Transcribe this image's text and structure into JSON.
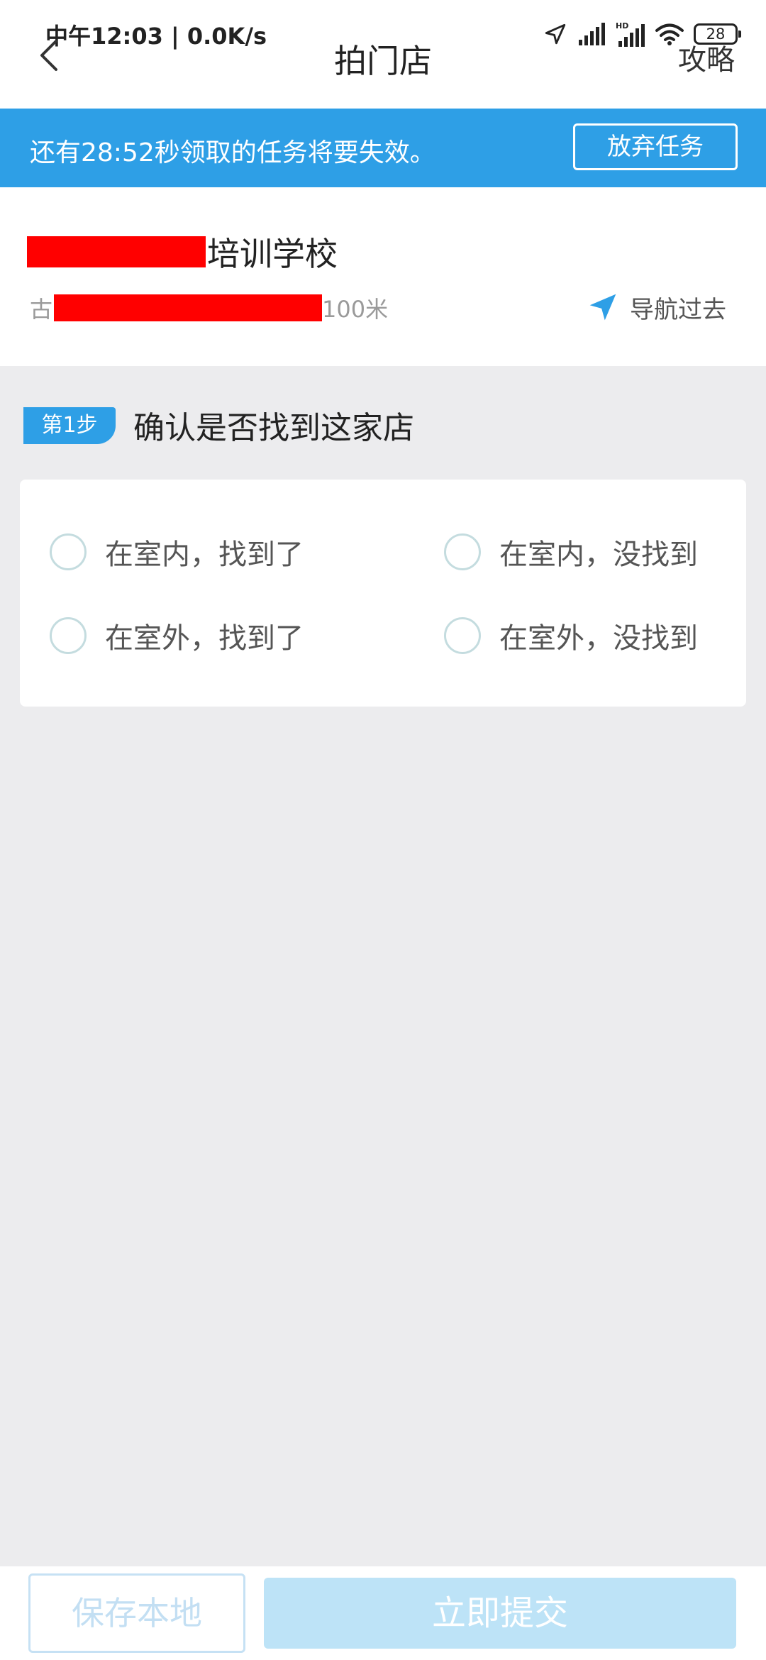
{
  "status_bar": {
    "time": "中午12:03 | 0.0K/s",
    "battery_level": "28",
    "icons": [
      "location-arrow-icon",
      "signal-icon",
      "hd-signal-icon",
      "wifi-icon",
      "battery-icon"
    ]
  },
  "nav_bar": {
    "title": "拍门店",
    "back_icon": "chevron-left-icon",
    "guide_label": "攻略"
  },
  "banner": {
    "countdown_text": "还有28:52秒领取的任务将要失效。",
    "abandon_label": "放弃任务",
    "background_color": "#2e9fe6"
  },
  "store": {
    "name_visible": "培训学校",
    "address_prefix": "古",
    "address_suffix": "100米",
    "navigate_label": "导航过去",
    "navigate_icon": "navigation-arrow-icon",
    "redaction_color": "#ff0000"
  },
  "step1": {
    "badge": "第1步",
    "title": "确认是否找到这家店",
    "options": [
      {
        "label": "在室内，找到了",
        "selected": false
      },
      {
        "label": "在室内，没找到",
        "selected": false
      },
      {
        "label": "在室外，找到了",
        "selected": false
      },
      {
        "label": "在室外，没找到",
        "selected": false
      }
    ]
  },
  "bottom_bar": {
    "save_local_label": "保存本地",
    "submit_label": "立即提交",
    "submit_color": "#bde3f7"
  }
}
